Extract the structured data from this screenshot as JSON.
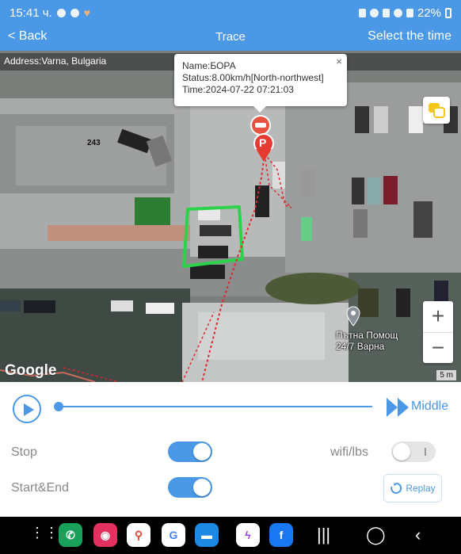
{
  "status_bar": {
    "time": "15:41 ч.",
    "battery": "22%"
  },
  "nav": {
    "back_label": "< Back",
    "title": "Trace",
    "select_time_label": "Select the time"
  },
  "map": {
    "address": "Address:Varna, Bulgaria",
    "popup": {
      "name": "Name:БОРА",
      "status": "Status:8.00km/h[North-northwest]",
      "time": "Time:2024-07-22 07:21:03",
      "close_label": "×"
    },
    "building_number": "243",
    "poi_line1": "Пътна Помощ",
    "poi_line2": "24/7 Варна",
    "google_logo": "Google",
    "scale_label": "5 m",
    "zoom_in": "+",
    "zoom_out": "−",
    "parking_marker": "P"
  },
  "playback": {
    "speed_label": "Middle",
    "progress": 0.0
  },
  "settings": {
    "stop_label": "Stop",
    "stop_on": true,
    "wifi_label": "wifi/lbs",
    "wifi_on": false,
    "start_end_label": "Start&End",
    "start_end_on": true,
    "replay_label": "Replay"
  },
  "colors": {
    "accent": "#4a98e6",
    "track": "#e0262e",
    "geofence": "#2bd24a"
  }
}
